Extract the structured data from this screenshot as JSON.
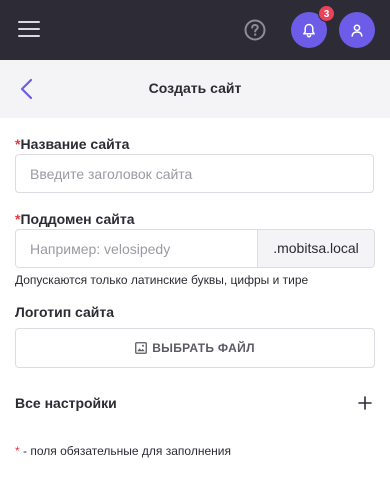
{
  "topbar": {
    "notifications_count": "3",
    "icons": {
      "menu": "hamburger-icon",
      "help": "question-circle-icon",
      "bell": "bell-icon",
      "user": "user-icon"
    }
  },
  "header": {
    "title": "Создать сайт",
    "back_icon": "chevron-left-icon"
  },
  "form": {
    "required_mark": "*",
    "site_name": {
      "label": "Название сайта",
      "value": "",
      "placeholder": "Введите заголовок сайта"
    },
    "subdomain": {
      "label": "Поддомен сайта",
      "value": "",
      "placeholder": "Например: velosipedy",
      "suffix": ".mobitsa.local",
      "hint": "Допускаются только латинские буквы, цифры и тире"
    },
    "logo": {
      "label": "Логотип сайта",
      "button_label": "ВЫБРАТЬ ФАЙЛ",
      "button_icon": "image-icon"
    },
    "all_settings": {
      "label": "Все настройки",
      "icon": "plus-icon"
    },
    "footnote": " - поля обязательные для заполнения"
  },
  "colors": {
    "topbar_bg": "#2d2c36",
    "accent": "#6c5ce7",
    "badge": "#e9435a",
    "required": "#e63946"
  }
}
